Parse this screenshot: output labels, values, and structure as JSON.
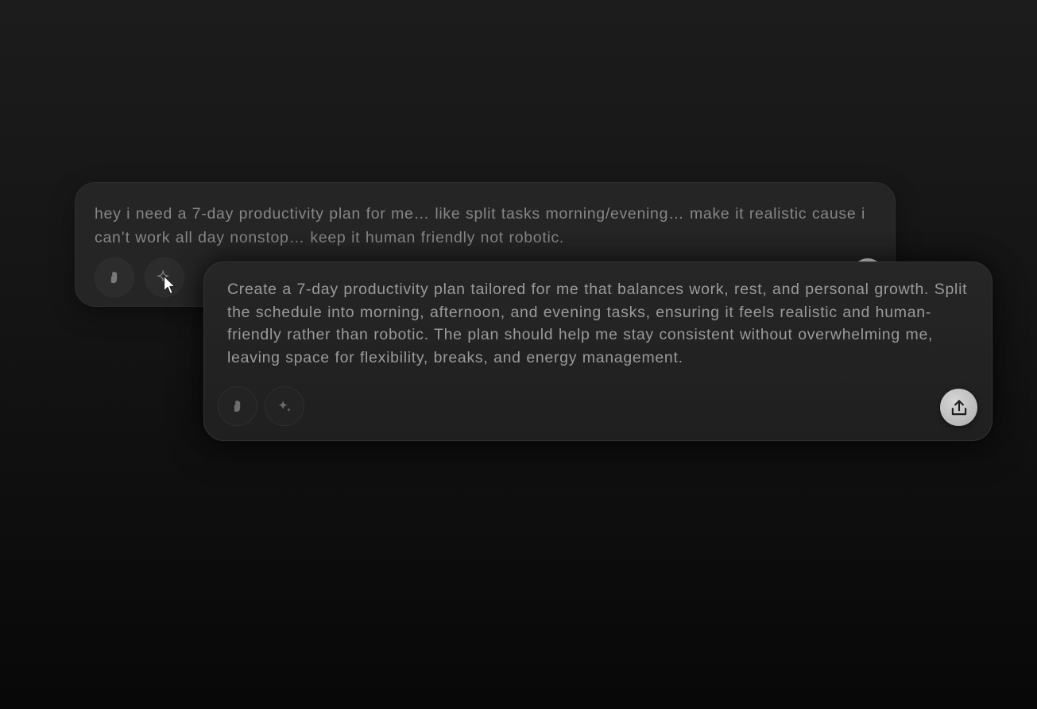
{
  "original_prompt": {
    "text": "hey i need a 7-day productivity plan for me… like split tasks morning/evening… make it realistic cause i can’t work all day nonstop… keep it human friendly not robotic.",
    "buttons": [
      {
        "icon": "hand-icon"
      },
      {
        "icon": "sparkle-icon"
      }
    ]
  },
  "enhanced_prompt": {
    "text": "Create a 7-day productivity plan tailored for me that balances work, rest, and personal growth. Split the schedule into morning, afternoon, and evening tasks, ensuring it feels realistic and human-friendly rather than robotic. The plan should help me stay consistent without overwhelming me, leaving space for flexibility, breaks, and energy management.",
    "buttons": [
      {
        "icon": "hand-icon"
      },
      {
        "icon": "sparkle-icon"
      }
    ],
    "submit_icon": "upload-icon"
  },
  "colors": {
    "background_top": "#1c1c1c",
    "background_bottom": "#080808",
    "card_back": "#252525",
    "card_front": "#222222",
    "text": "#9a9a9a",
    "upload_button": "#c4c4c4"
  }
}
